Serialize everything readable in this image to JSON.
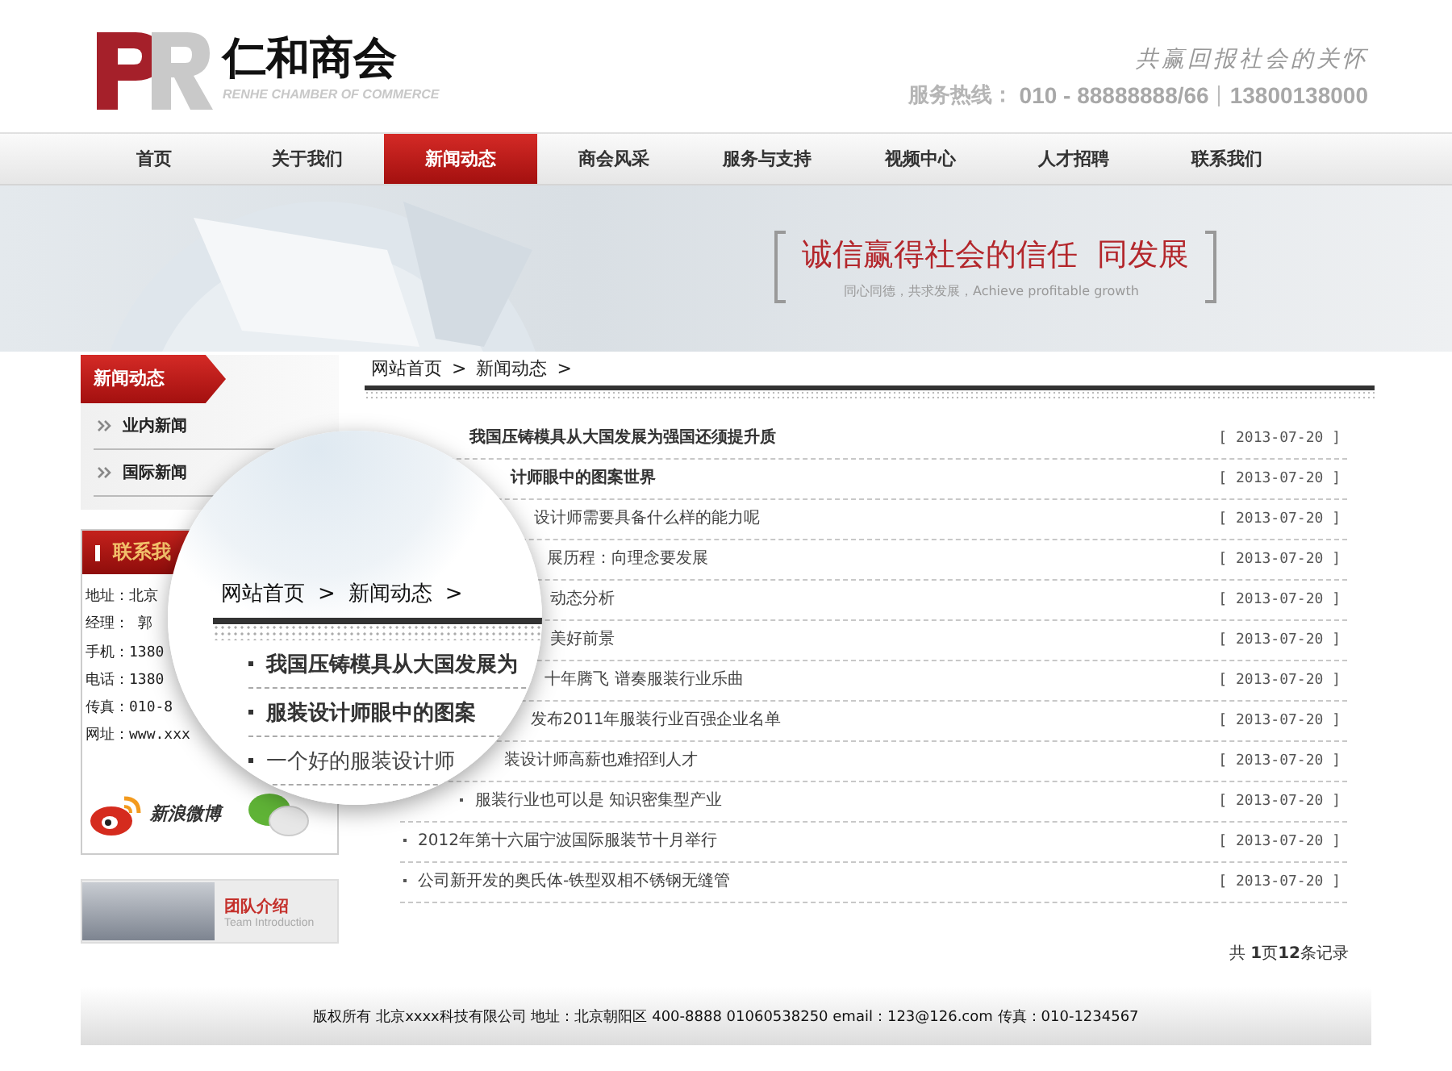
{
  "header": {
    "logo_text": "仁和商会",
    "logo_subtitle": "RENHE CHAMBER OF COMMERCE",
    "slogan": "共赢回报社会的关怀",
    "hotline_label": "服务热线：",
    "hotline_phone": "010 - 88888888/66",
    "hotline_mobile": "13800138000"
  },
  "nav": [
    {
      "label": "首页",
      "selected": false
    },
    {
      "label": "关于我们",
      "selected": false
    },
    {
      "label": "新闻动态",
      "selected": true
    },
    {
      "label": "商会风采",
      "selected": false
    },
    {
      "label": "服务与支持",
      "selected": false
    },
    {
      "label": "视频中心",
      "selected": false
    },
    {
      "label": "人才招聘",
      "selected": false
    },
    {
      "label": "联系我们",
      "selected": false
    }
  ],
  "banner": {
    "headline": "诚信赢得社会的信任",
    "headline_2": "同发展",
    "tagline": "同心同德，共求发展，Achieve profitable growth"
  },
  "sidebar": {
    "section_title": "新闻动态",
    "items": [
      "业内新闻",
      "国际新闻"
    ],
    "contact_title": "联系我",
    "contact_lines": [
      "地址：北京",
      "经理： 郭",
      "手机：1380",
      "电话：1380",
      "传真：010-8",
      "网址：www.xxx"
    ],
    "weibo_label": "新浪微博",
    "team_title": "团队介绍",
    "team_subtitle": "Team Introduction"
  },
  "breadcrumb": {
    "items": [
      "网站首页",
      "新闻动态"
    ],
    "separator": ">"
  },
  "news": [
    {
      "title": "我国压铸模具从大国发展为强国还须提升质",
      "date": "[ 2013-07-20 ]",
      "bold": true,
      "bullet_visible": false
    },
    {
      "title": "计师眼中的图案世界",
      "date": "[ 2013-07-20 ]",
      "bold": true,
      "bullet_visible": false
    },
    {
      "title": "设计师需要具备什么样的能力呢",
      "date": "[ 2013-07-20 ]",
      "bold": false,
      "bullet_visible": false
    },
    {
      "title": "展历程：向理念要发展",
      "date": "[ 2013-07-20 ]",
      "bold": false,
      "bullet_visible": false
    },
    {
      "title": "动态分析",
      "date": "[ 2013-07-20 ]",
      "bold": false,
      "bullet_visible": false
    },
    {
      "title": "美好前景",
      "date": "[ 2013-07-20 ]",
      "bold": false,
      "bullet_visible": false
    },
    {
      "title": "十年腾飞 谱奏服装行业乐曲",
      "date": "[ 2013-07-20 ]",
      "bold": false,
      "bullet_visible": false
    },
    {
      "title": "发布2011年服装行业百强企业名单",
      "date": "[ 2013-07-20 ]",
      "bold": false,
      "bullet_visible": false
    },
    {
      "title": "装设计师高薪也难招到人才",
      "date": "[ 2013-07-20 ]",
      "bold": false,
      "bullet_visible": false
    },
    {
      "title": "服装行业也可以是 知识密集型产业",
      "date": "[ 2013-07-20 ]",
      "bold": false,
      "bullet_visible": true
    },
    {
      "title": "2012年第十六届宁波国际服装节十月举行",
      "date": "[ 2013-07-20 ]",
      "bold": false,
      "bullet_visible": true
    },
    {
      "title": "公司新开发的奥氏体-铁型双相不锈钢无缝管",
      "date": "[ 2013-07-20 ]",
      "bold": false,
      "bullet_visible": true
    }
  ],
  "pager": "共 **1**页**12**条记录",
  "magnifier": {
    "breadcrumb": [
      "网站首页",
      "新闻动态"
    ],
    "separator": ">",
    "items": [
      {
        "title": "我国压铸模具从大国发展为",
        "bold": true
      },
      {
        "title": "服装设计师眼中的图案",
        "bold": true
      },
      {
        "title": "一个好的服装设计师",
        "bold": false
      }
    ]
  },
  "footer": "版权所有 北京xxxx科技有限公司 地址：北京朝阳区 400-8888 01060538250 email：123@126.com 传真：010-1234567"
}
